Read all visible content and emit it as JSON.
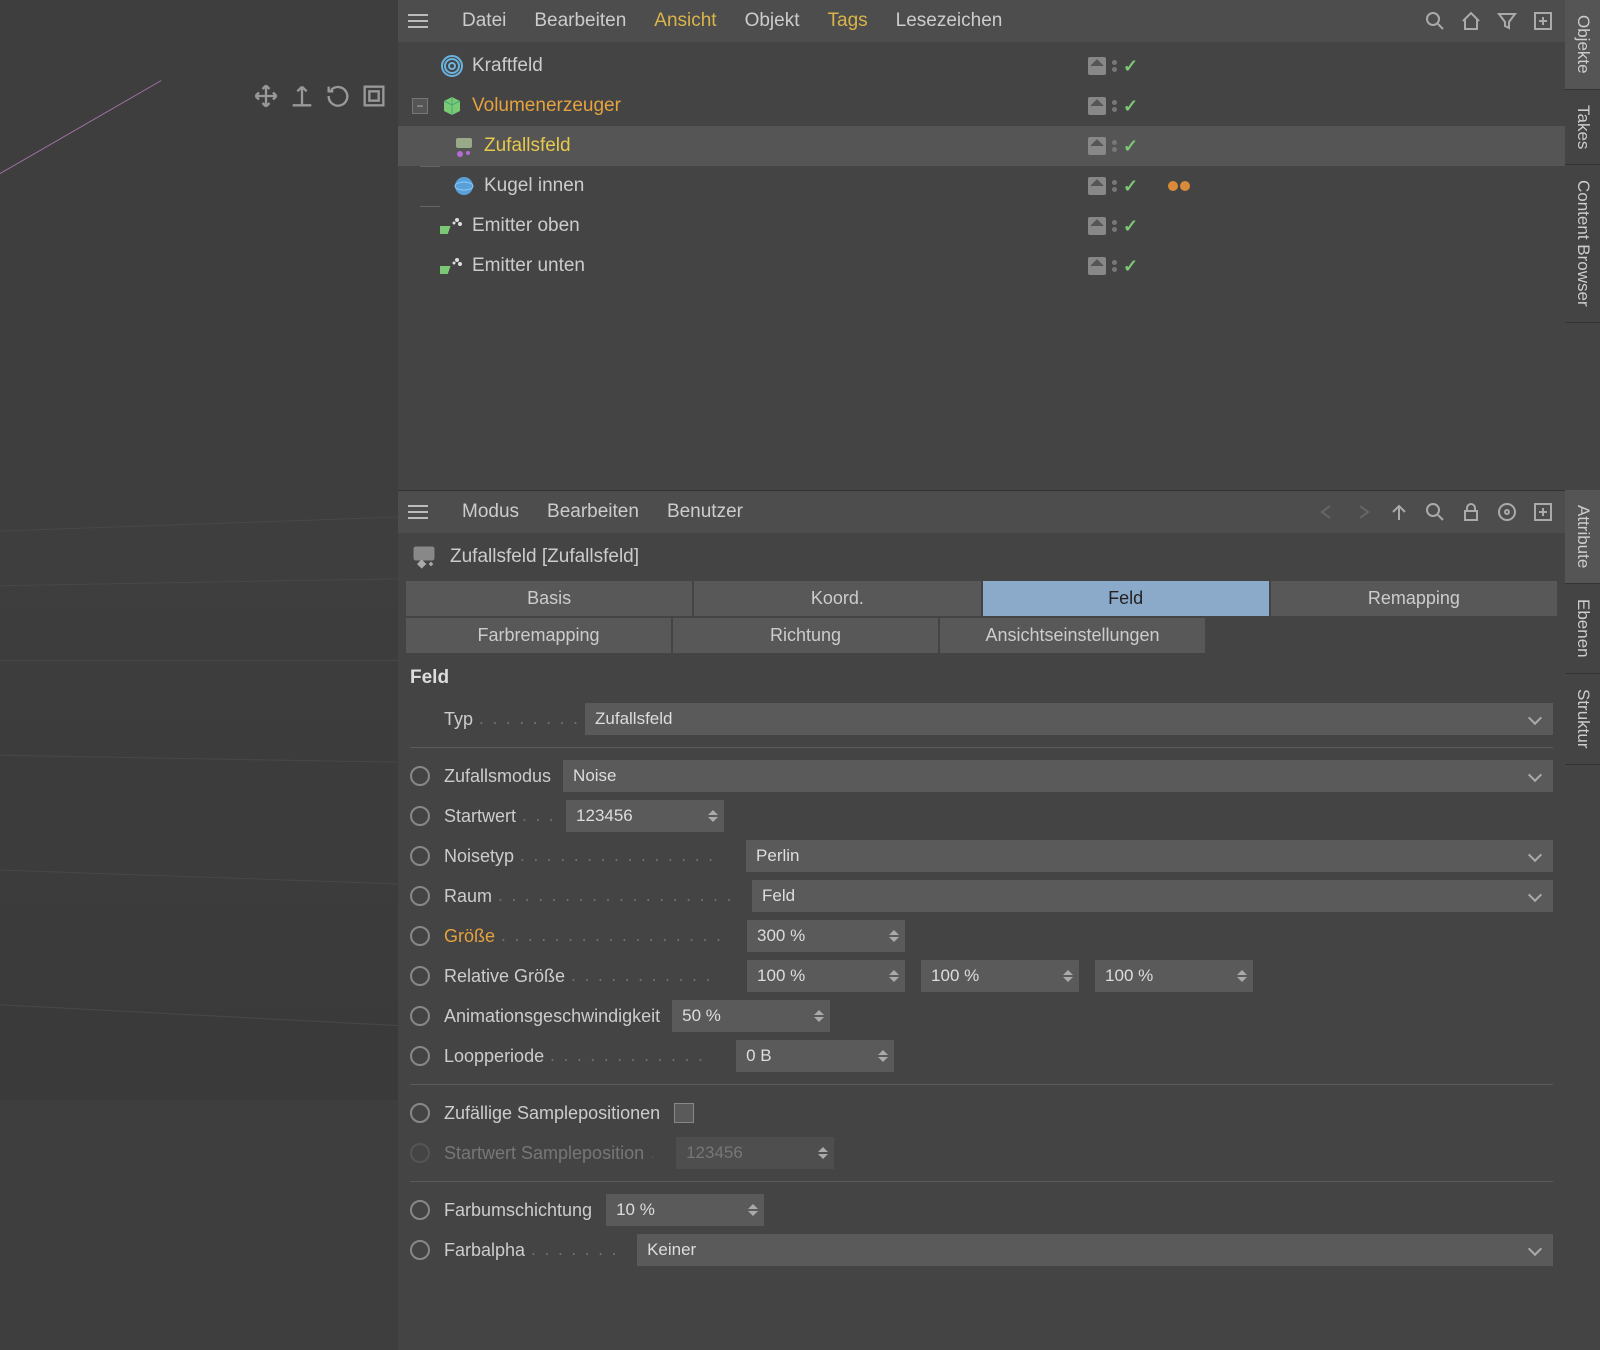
{
  "side_tabs": [
    "Objekte",
    "Takes",
    "Content Browser",
    "Attribute",
    "Ebenen",
    "Struktur"
  ],
  "obj_menu": {
    "items": [
      "Datei",
      "Bearbeiten",
      "Ansicht",
      "Objekt",
      "Tags",
      "Lesezeichen"
    ],
    "highlight": [
      2,
      4
    ]
  },
  "tree": [
    {
      "label": "Kraftfeld",
      "indent": 0,
      "color": "",
      "icon": "force",
      "sel": false,
      "tags": 0
    },
    {
      "label": "Volumenerzeuger",
      "indent": 0,
      "color": "orange",
      "icon": "volume",
      "sel": false,
      "exp": true,
      "tags": 0
    },
    {
      "label": "Zufallsfeld",
      "indent": 1,
      "color": "yellow",
      "icon": "random",
      "sel": true,
      "tags": 0
    },
    {
      "label": "Kugel innen",
      "indent": 1,
      "color": "",
      "icon": "sphere",
      "sel": false,
      "tags": 2
    },
    {
      "label": "Emitter oben",
      "indent": 0,
      "color": "",
      "icon": "emitter",
      "sel": false,
      "tags": 0
    },
    {
      "label": "Emitter unten",
      "indent": 0,
      "color": "",
      "icon": "emitter",
      "sel": false,
      "tags": 0
    }
  ],
  "attr_menu": [
    "Modus",
    "Bearbeiten",
    "Benutzer"
  ],
  "attr_title": "Zufallsfeld [Zufallsfeld]",
  "tabs_row1": [
    "Basis",
    "Koord.",
    "Feld",
    "Remapping"
  ],
  "tabs_row2": [
    "Farbremapping",
    "Richtung",
    "Ansichtseinstellungen"
  ],
  "tabs_active": "Feld",
  "section": "Feld",
  "props": {
    "typ_label": "Typ",
    "typ_value": "Zufallsfeld",
    "zmod_label": "Zufallsmodus",
    "zmod_value": "Noise",
    "start_label": "Startwert",
    "start_value": "123456",
    "noisetype_label": "Noisetyp",
    "noisetype_value": "Perlin",
    "raum_label": "Raum",
    "raum_value": "Feld",
    "groesse_label": "Größe",
    "groesse_value": "300 %",
    "relg_label": "Relative Größe",
    "relg_x": "100 %",
    "relg_y": "100 %",
    "relg_z": "100 %",
    "anim_label": "Animationsgeschwindigkeit",
    "anim_value": "50 %",
    "loop_label": "Loopperiode",
    "loop_value": "0 B",
    "sample_label": "Zufällige Samplepositionen",
    "samplestart_label": "Startwert Sampleposition",
    "samplestart_value": "123456",
    "farbum_label": "Farbumschichtung",
    "farbum_value": "10 %",
    "farbalpha_label": "Farbalpha",
    "farbalpha_value": "Keiner"
  }
}
